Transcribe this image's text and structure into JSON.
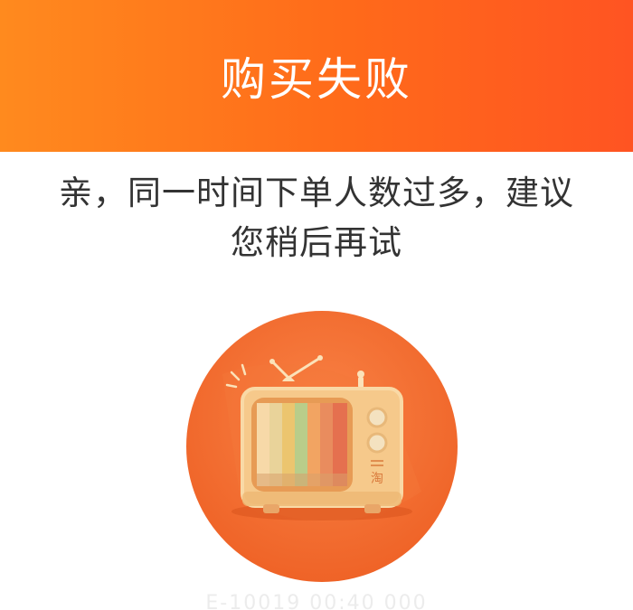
{
  "header": {
    "title": "购买失败",
    "gradient_start": "#ff8a1e",
    "gradient_end": "#ff5422"
  },
  "message": {
    "line1": "亲，同一时间下单人数过多，建议",
    "line2": "您稍后再试"
  },
  "illustration": {
    "icon": "retro-tv-icon",
    "badge_text": "淘",
    "circle_color": "#f26a2a",
    "test_bar_colors": [
      "#f7d9a8",
      "#e9d39a",
      "#ecc56f",
      "#b9cd8a",
      "#f2a462",
      "#e98c5e",
      "#e5704f"
    ]
  },
  "footer": {
    "text": "E-10019 00:40 000"
  }
}
